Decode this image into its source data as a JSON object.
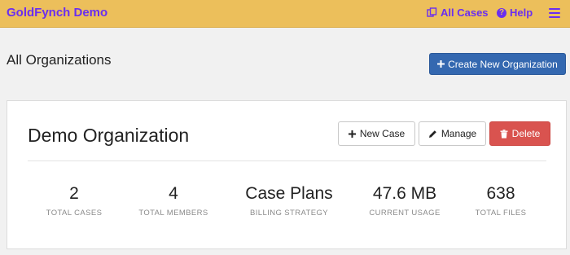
{
  "navbar": {
    "brand": "GoldFynch Demo",
    "all_cases_label": "All Cases",
    "help_label": "Help",
    "menu_icon": "hamburger-icon",
    "accent_color": "#6a2ef0",
    "background_color": "#ecbf5b"
  },
  "page": {
    "heading": "All Organizations",
    "create_button_label": "Create New Organization"
  },
  "organization": {
    "name": "Demo Organization",
    "actions": {
      "new_case_label": "New Case",
      "manage_label": "Manage",
      "delete_label": "Delete"
    },
    "stats": [
      {
        "value": "2",
        "label": "TOTAL CASES"
      },
      {
        "value": "4",
        "label": "TOTAL MEMBERS"
      },
      {
        "value": "Case Plans",
        "label": "BILLING STRATEGY"
      },
      {
        "value": "47.6 MB",
        "label": "CURRENT USAGE"
      },
      {
        "value": "638",
        "label": "TOTAL FILES"
      }
    ]
  }
}
